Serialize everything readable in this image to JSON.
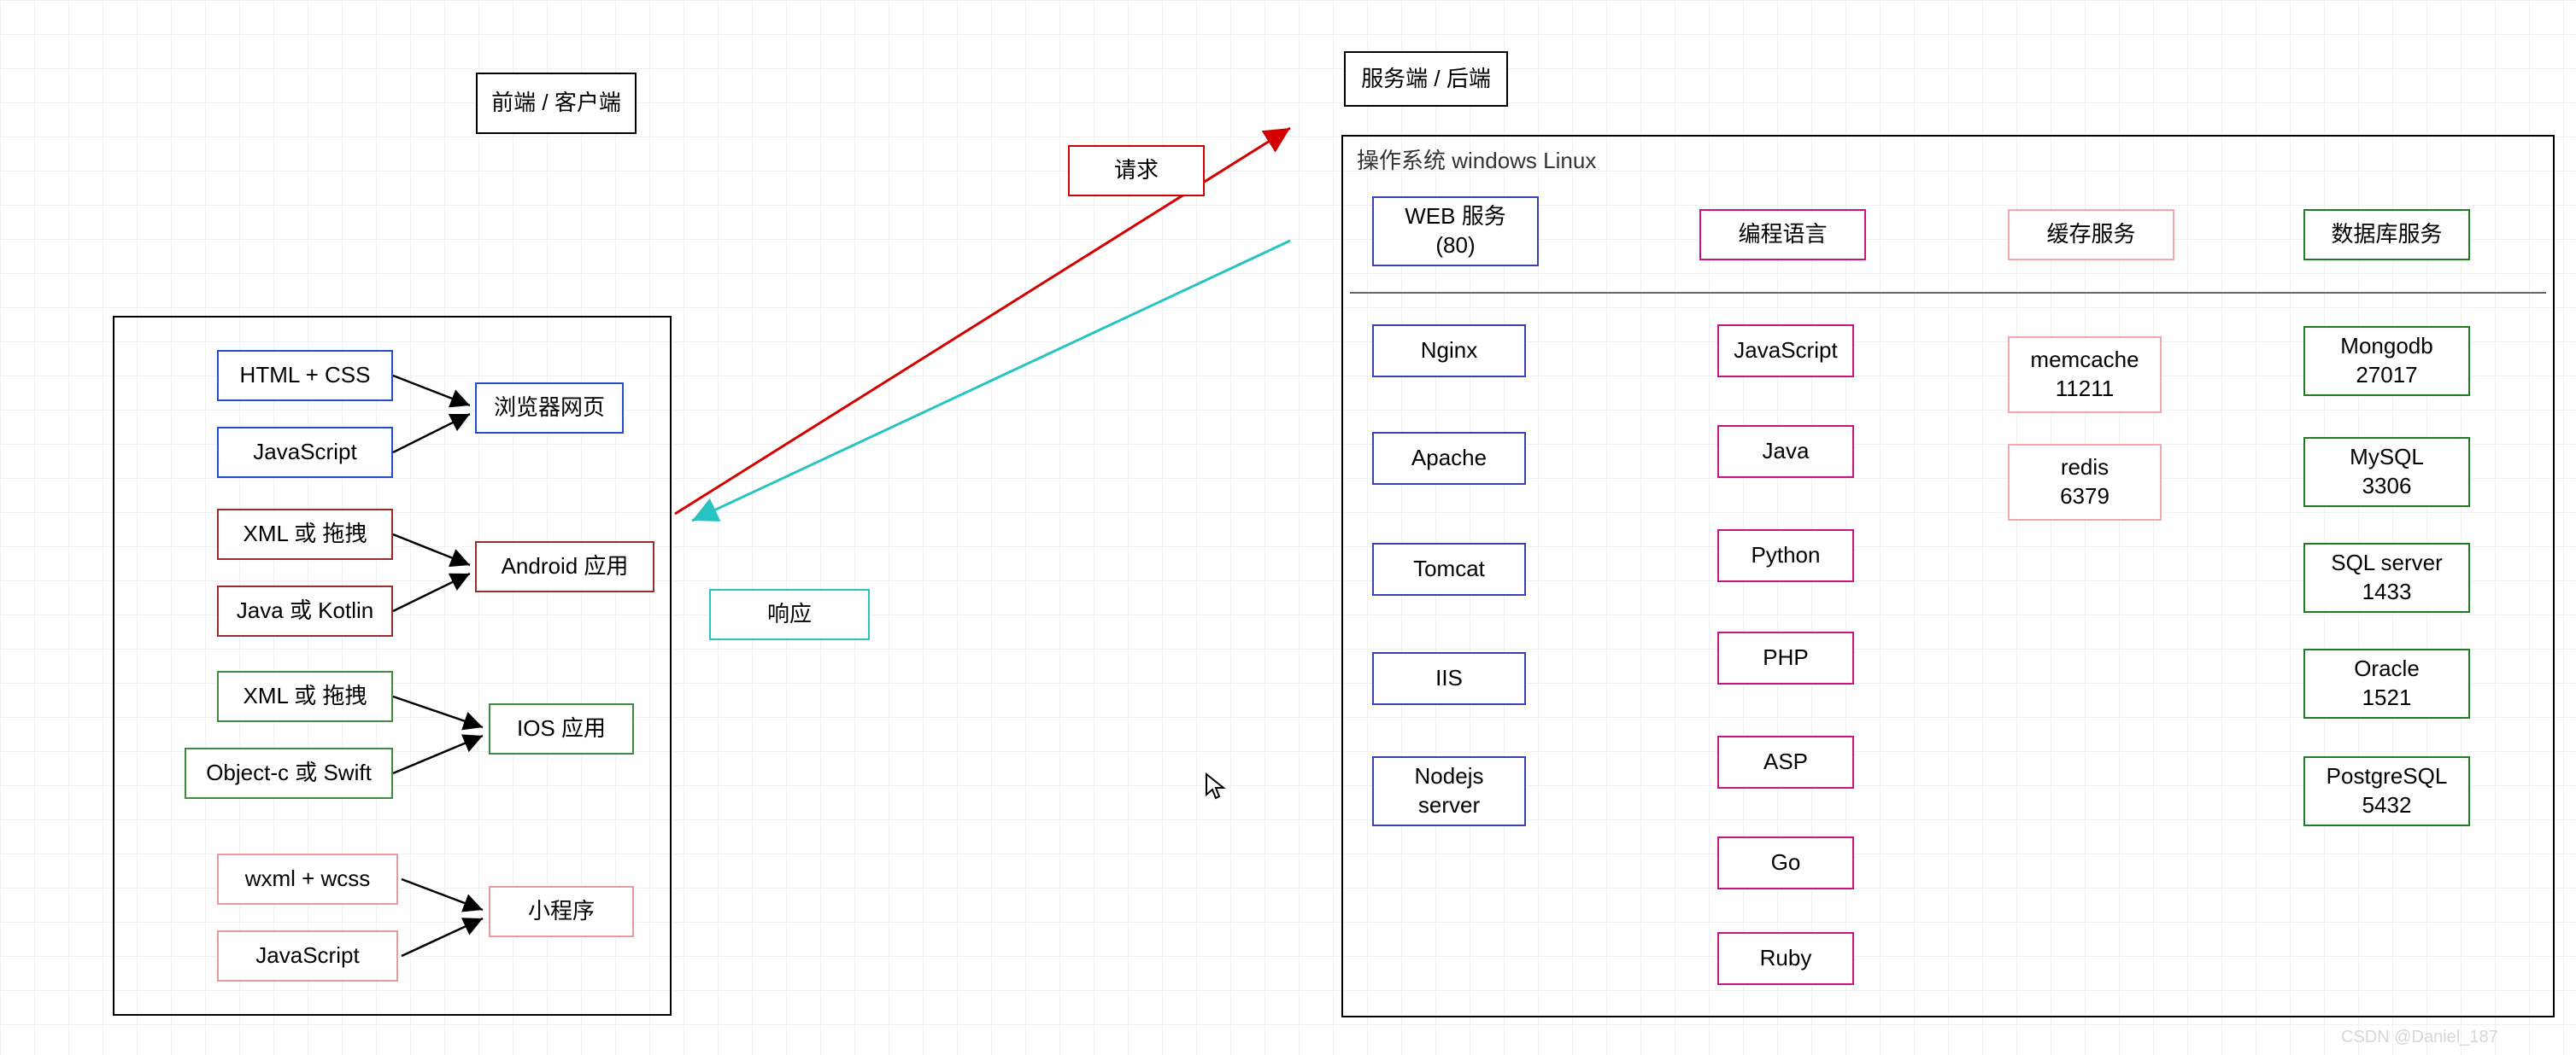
{
  "frontend": {
    "title": "前端 / 客户端",
    "groups": {
      "web": {
        "items": [
          "HTML + CSS",
          "JavaScript"
        ],
        "target": "浏览器网页"
      },
      "android": {
        "items": [
          "XML 或 拖拽",
          "Java 或 Kotlin"
        ],
        "target": "Android 应用"
      },
      "ios": {
        "items": [
          "XML 或 拖拽",
          "Object-c 或 Swift"
        ],
        "target": "IOS 应用"
      },
      "mini": {
        "items": [
          "wxml + wcss",
          "JavaScript"
        ],
        "target": "小程序"
      }
    }
  },
  "messages": {
    "request": "请求",
    "response": "响应"
  },
  "backend": {
    "title": "服务端 / 后端",
    "os_note": "操作系统  windows   Linux",
    "columns": {
      "web_service": {
        "header": "WEB 服务\n(80)",
        "items": [
          "Nginx",
          "Apache",
          "Tomcat",
          "IIS",
          "Nodejs\nserver"
        ]
      },
      "lang": {
        "header": "编程语言",
        "items": [
          "JavaScript",
          "Java",
          "Python",
          "PHP",
          "ASP",
          "Go",
          "Ruby"
        ]
      },
      "cache": {
        "header": "缓存服务",
        "items": [
          "memcache\n11211",
          "redis\n6379"
        ]
      },
      "db": {
        "header": "数据库服务",
        "items": [
          "Mongodb\n27017",
          "MySQL\n3306",
          "SQL server\n1433",
          "Oracle\n1521",
          "PostgreSQL\n5432"
        ]
      }
    }
  },
  "watermark": "CSDN @Daniel_187"
}
